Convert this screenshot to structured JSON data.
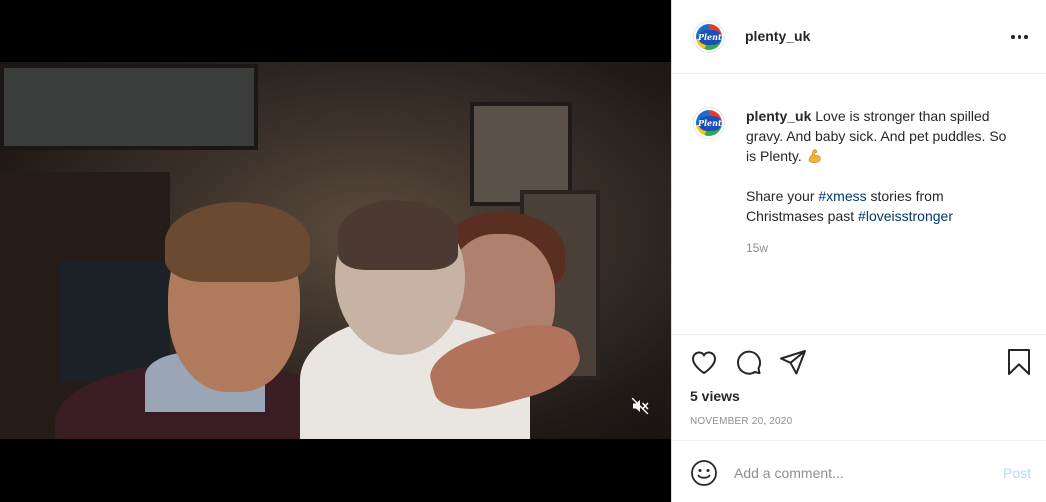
{
  "post": {
    "username": "plenty_uk",
    "avatar_text": "Plenty",
    "caption": {
      "username": "plenty_uk",
      "line1": "Love is stronger than spilled gravy. And baby sick. And pet puddles. So is Plenty.",
      "line2_prefix": "Share your",
      "hashtag1": "#xmess",
      "line2_middle": "stories from Christmases past",
      "hashtag2": "#loveisstronger"
    },
    "timestamp": "15w",
    "views": "5 views",
    "date": "NOVEMBER 20, 2020"
  },
  "icons": {
    "more": "more-options-icon",
    "mute": "muted-speaker-icon",
    "like": "heart-icon",
    "comment": "comment-bubble-icon",
    "share": "paper-plane-icon",
    "save": "bookmark-icon",
    "emoji": "smiley-icon",
    "caption_emoji": "flexed-biceps-emoji"
  },
  "comment_box": {
    "placeholder": "Add a comment...",
    "post_label": "Post"
  },
  "colors": {
    "hashtag": "#00376b",
    "post_disabled": "#b3dbff",
    "muted_text": "#8e8e8e"
  }
}
